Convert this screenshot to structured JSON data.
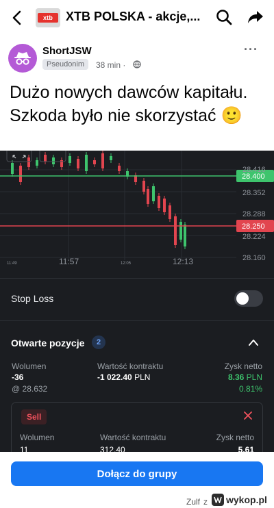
{
  "header": {
    "group_title": "XTB POLSKA - akcje,...",
    "group_logo_text": "xtb",
    "back_icon": "chevron-left-icon",
    "search_icon": "search-icon",
    "share_icon": "share-icon"
  },
  "post": {
    "author": "ShortJSW",
    "badge": "Pseudonim",
    "time": "38 min",
    "dot": "·",
    "more_icon": "more-icon",
    "more_label": "···",
    "text": "Dużo nowych dawców kapitału. Szkoda było nie skorzystać 🙂"
  },
  "trading": {
    "price_labels": [
      "28.416",
      "28.352",
      "28.288",
      "28.224",
      "28.160"
    ],
    "bid_price": "28.400",
    "ask_price": "28.250",
    "time_labels": {
      "t1": "11:49",
      "t2": "11:57",
      "t3": "12:05",
      "t4": "12:13"
    },
    "stop_loss_label": "Stop Loss",
    "stop_loss_on": false,
    "open_positions_label": "Otwarte pozycje",
    "open_positions_count": "2",
    "summary": {
      "volume_label": "Wolumen",
      "volume": "-36",
      "avg_price": "@ 28.632",
      "contract_label": "Wartość kontraktu",
      "contract_value": "-1 022.40",
      "contract_currency": "PLN",
      "profit_label": "Zysk netto",
      "profit_value": "8.36",
      "profit_currency": "PLN",
      "profit_pct": "0.81%"
    },
    "position": {
      "side": "Sell",
      "volume_label": "Wolumen",
      "volume": "11",
      "contract_label": "Wartość kontraktu",
      "contract_value": "312.40",
      "profit_label": "Zysk netto",
      "profit_value": "5.61"
    },
    "colors": {
      "up": "#3ec46d",
      "down": "#e2454f",
      "bid_line": "#3ec46d",
      "ask_line": "#e2454f"
    }
  },
  "footer": {
    "join_label": "Dołącz do grupy",
    "watermark_user": "Zulf",
    "watermark_z": "z",
    "watermark_site": "wykop.pl"
  }
}
